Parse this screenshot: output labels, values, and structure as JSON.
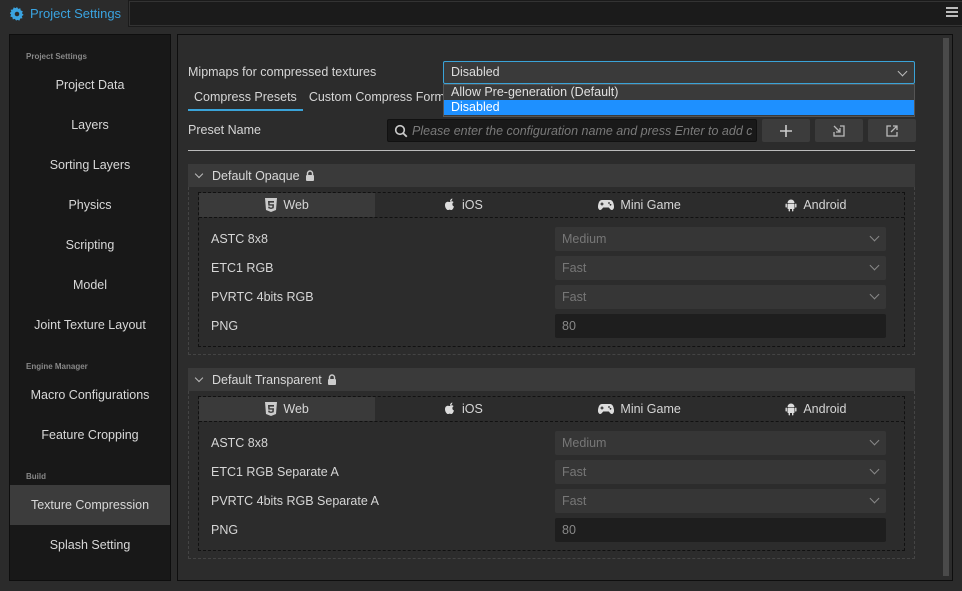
{
  "window": {
    "tab_title": "Project Settings",
    "tab_icon": "gear-icon",
    "accent_color": "#3aa3e0"
  },
  "sidebar": {
    "groups": [
      {
        "label": "Project Settings",
        "items": [
          "Project Data",
          "Layers",
          "Sorting Layers",
          "Physics",
          "Scripting",
          "Model",
          "Joint Texture Layout"
        ]
      },
      {
        "label": "Engine Manager",
        "items": [
          "Macro Configurations",
          "Feature Cropping"
        ]
      },
      {
        "label": "Build",
        "items": [
          "Texture Compression",
          "Splash Setting"
        ]
      }
    ],
    "active_item": "Texture Compression"
  },
  "main": {
    "mipmaps_label": "Mipmaps for compressed textures",
    "mipmaps_value": "Disabled",
    "mipmaps_options": [
      "Allow Pre-generation (Default)",
      "Disabled"
    ],
    "mipmaps_selected_option": "Disabled",
    "tabs": [
      {
        "label": "Compress Presets",
        "active": true
      },
      {
        "label": "Custom Compress Format",
        "active": false
      }
    ],
    "preset_name_label": "Preset Name",
    "search_placeholder": "Please enter the configuration name and press Enter to add cu",
    "toolbar": {
      "add_icon": "plus-icon",
      "import_icon": "import-icon",
      "export_icon": "export-icon"
    },
    "sections": [
      {
        "title": "Default Opaque",
        "locked": true,
        "platform_tabs": [
          "Web",
          "iOS",
          "Mini Game",
          "Android"
        ],
        "active_platform": "Web",
        "rows": [
          {
            "name": "ASTC 8x8",
            "type": "select",
            "value": "Medium"
          },
          {
            "name": "ETC1 RGB",
            "type": "select",
            "value": "Fast"
          },
          {
            "name": "PVRTC 4bits RGB",
            "type": "select",
            "value": "Fast"
          },
          {
            "name": "PNG",
            "type": "number",
            "value": "80"
          }
        ]
      },
      {
        "title": "Default Transparent",
        "locked": true,
        "platform_tabs": [
          "Web",
          "iOS",
          "Mini Game",
          "Android"
        ],
        "active_platform": "Web",
        "rows": [
          {
            "name": "ASTC 8x8",
            "type": "select",
            "value": "Medium"
          },
          {
            "name": "ETC1 RGB Separate A",
            "type": "select",
            "value": "Fast"
          },
          {
            "name": "PVRTC 4bits RGB Separate A",
            "type": "select",
            "value": "Fast"
          },
          {
            "name": "PNG",
            "type": "number",
            "value": "80"
          }
        ]
      }
    ]
  }
}
